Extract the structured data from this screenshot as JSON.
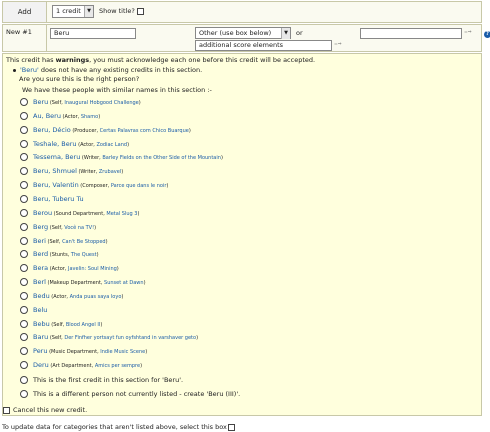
{
  "add_bar": {
    "add_label": "Add",
    "credit_count": "1 credit",
    "show_title_label": "Show title?"
  },
  "new_row": {
    "label": "New #1",
    "name_value": "Beru",
    "role_selected": "Other (use box below)",
    "or_label": "or",
    "score_value": "additional score elements",
    "arrow_glyph": "=⇒",
    "help_glyph": "?"
  },
  "warning": {
    "pre": "This credit has ",
    "bold": "warnings",
    "post": ", you must acknowledge each one before this credit will be accepted.",
    "bullet_name": "'Beru'",
    "bullet_rest": " does not have any existing credits in this section.",
    "sure": "Are you sure this is the right person?",
    "similar": "We have these people with similar names in this section :-"
  },
  "options": [
    {
      "name": "Beru",
      "role": " (Self, ",
      "link": "Inaugural Hobgood Challenge",
      "close": ")"
    },
    {
      "name": "Au, Beru",
      "role": " (Actor, ",
      "link": "Shamo",
      "close": ")"
    },
    {
      "name": "Beru, Décio",
      "role": " (Producer, ",
      "link": "Certas Palavras com Chico Buarque",
      "close": ")"
    },
    {
      "name": "Teshale, Beru",
      "role": " (Actor, ",
      "link": "Zodiac Land",
      "close": ")"
    },
    {
      "name": "Tessema, Beru",
      "role": " (Writer, ",
      "link": "Barley Fields on the Other Side of the Mountain",
      "close": ")"
    },
    {
      "name": "Beru, Shmuel",
      "role": " (Writer, ",
      "link": "Zrubavel",
      "close": ")"
    },
    {
      "name": "Beru, Valentin",
      "role": " (Composer, ",
      "link": "Parce que dans le noir",
      "close": ")"
    },
    {
      "name": "Beru, Tuberu Tu",
      "role": "",
      "link": "",
      "close": ""
    },
    {
      "name": "Berou",
      "role": " (Sound Department, ",
      "link": "Metal Slug 3",
      "close": ")"
    },
    {
      "name": "Berg",
      "role": " (Self, ",
      "link": "Você na TV!",
      "close": ")"
    },
    {
      "name": "Beri",
      "role": " (Self, ",
      "link": "Can't Be Stopped",
      "close": ")"
    },
    {
      "name": "Berd",
      "role": " (Stunts, ",
      "link": "The Quest",
      "close": ")"
    },
    {
      "name": "Bera",
      "role": " (Actor, ",
      "link": "Javelin: Soul Mining",
      "close": ")"
    },
    {
      "name": "Berl",
      "role": " (Makeup Department, ",
      "link": "Sunset at Dawn",
      "close": ")"
    },
    {
      "name": "Bedu",
      "role": " (Actor, ",
      "link": "Anda puas saya loyo",
      "close": ")"
    },
    {
      "name": "Belu",
      "role": "",
      "link": "",
      "close": ""
    },
    {
      "name": "Bebu",
      "role": " (Self, ",
      "link": "Blood Angel II",
      "close": ")"
    },
    {
      "name": "Baru",
      "role": " (Self, ",
      "link": "Der Finfher yortsayt fun oyfshtand in varshaver geto",
      "close": ")"
    },
    {
      "name": "Peru",
      "role": " (Music Department, ",
      "link": "Indie Music Scene",
      "close": ")"
    },
    {
      "name": "Deru",
      "role": " (Art Department, ",
      "link": "Amics per sempre",
      "close": ")"
    }
  ],
  "first_credit": "This is the first credit in this section for 'Beru'.",
  "different_person": "This is a different person not currently listed - create 'Beru (III)'.",
  "cancel": "Cancel this new credit.",
  "footer": "To update data for categories that aren't listed above, select this box"
}
